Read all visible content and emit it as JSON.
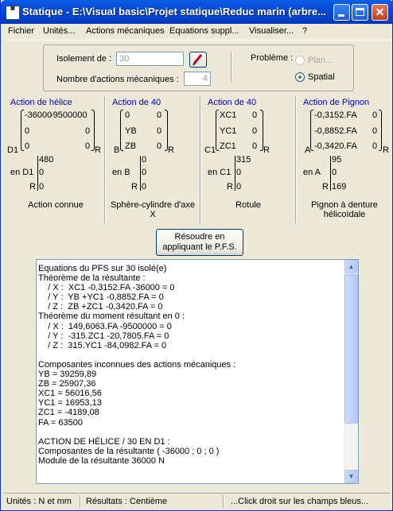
{
  "window": {
    "title": "Statique - E:\\Visual basic\\Projet statique\\Reduc marin (arbre...",
    "icon_label": "Statique"
  },
  "menu": [
    "Fichier",
    "Unités...",
    "Actions mécaniques",
    "Equations suppl...",
    "Visualiser...",
    "?"
  ],
  "top_panel": {
    "isolement_label": "Isolement de :",
    "isolement_value": "30",
    "nombre_label": "Nombre d'actions mécaniques :",
    "nombre_value": "4",
    "probleme_label": "Problème :",
    "plan_label": "Plan...",
    "spatial_label": "Spatial",
    "selected": "Spatial"
  },
  "actions": [
    {
      "title": "Action de hélice",
      "point": "D1",
      "matrix": [
        [
          "-36000",
          "-9500000"
        ],
        [
          "0",
          "0"
        ],
        [
          "0",
          "0"
        ]
      ],
      "r_label": "R",
      "norm_top": "480",
      "en_label": "en D1",
      "coords": [
        "0",
        "0"
      ],
      "r_side": "R",
      "caption": "Action connue"
    },
    {
      "title": "Action de 40",
      "point": "B",
      "matrix": [
        [
          "0",
          "0"
        ],
        [
          "YB",
          "0"
        ],
        [
          "ZB",
          "0"
        ]
      ],
      "r_label": "R",
      "norm_top": "0",
      "en_label": "en B",
      "coords": [
        "0",
        "0"
      ],
      "r_side": "R",
      "caption": "Sphère-cylindre d'axe X"
    },
    {
      "title": "Action de 40",
      "point": "C1",
      "matrix": [
        [
          "XC1",
          "0"
        ],
        [
          "YC1",
          "0"
        ],
        [
          "ZC1",
          "0"
        ]
      ],
      "r_label": "R",
      "norm_top": "315",
      "en_label": "en C1",
      "coords": [
        "0",
        "0"
      ],
      "r_side": "R",
      "caption": "Rotule"
    },
    {
      "title": "Action de Pignon",
      "point": "A",
      "matrix": [
        [
          "-0,3152.FA",
          "0"
        ],
        [
          "-0,8852.FA",
          "0"
        ],
        [
          "-0,3420.FA",
          "0"
        ]
      ],
      "r_label": "R",
      "norm_top": "95",
      "en_label": "en A",
      "coords": [
        "0",
        "169"
      ],
      "r_side": "R",
      "caption": "Pignon à denture hélicoïdale"
    }
  ],
  "solve_button": "Résoudre en appliquant le P.F.S.",
  "results_lines": [
    "Equations du PFS sur 30 isolé(e)",
    "Théorème de la résultante :",
    "    / X :  XC1 -0,3152.FA -36000 = 0",
    "    / Y :  YB +YC1 -0,8852.FA = 0",
    "    / Z :  ZB +ZC1 -0,3420.FA = 0",
    "Théorème du moment résultant en 0 :",
    "    / X :  149,6063.FA -9500000 = 0",
    "    / Y :  -315.ZC1 -20,7805.FA = 0",
    "    / Z :  315.YC1 -84,0982.FA = 0",
    "",
    "Composantes inconnues des actions mécaniques :",
    "YB = 39259,89",
    "ZB = 25907,36",
    "XC1 = 56016,56",
    "YC1 = 16953,13",
    "ZC1 = -4189,08",
    "FA = 63500",
    "",
    "ACTION DE HÉLICE / 30 EN D1 :",
    "Composantes de la résultante ( -36000 ; 0 ; 0 )",
    "Module de la résultante 36000 N"
  ],
  "status": {
    "units": "Unités : N et mm",
    "results": "Résultats : Centième",
    "hint": "...Click droit sur les champs bleus..."
  }
}
